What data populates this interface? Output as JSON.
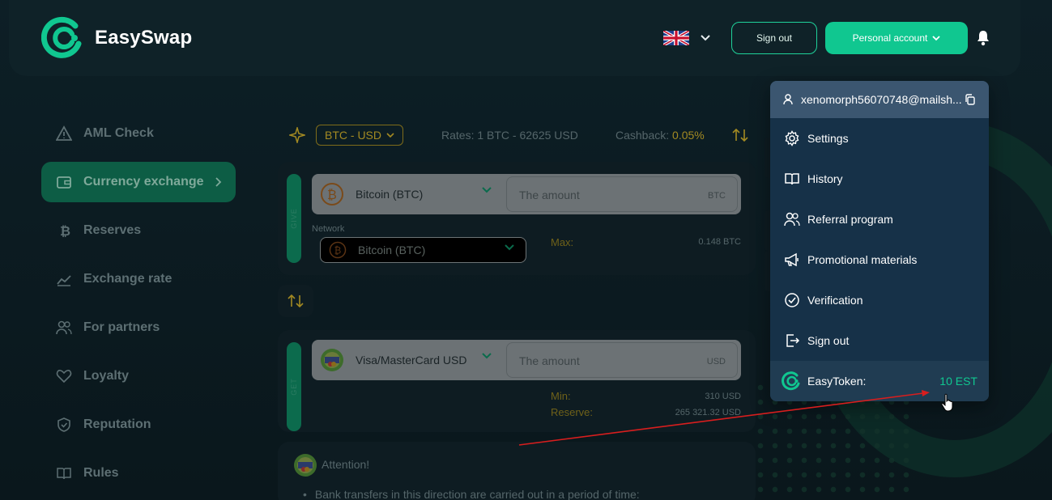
{
  "header": {
    "brand": "EasySwap",
    "sign_out_label": "Sign out",
    "account_label": "Personal account"
  },
  "sidebar": {
    "items": [
      {
        "label": "AML Check"
      },
      {
        "label": "Currency exchange"
      },
      {
        "label": "Reserves"
      },
      {
        "label": "Exchange rate"
      },
      {
        "label": "For partners"
      },
      {
        "label": "Loyalty"
      },
      {
        "label": "Reputation"
      },
      {
        "label": "Rules"
      }
    ]
  },
  "exchange": {
    "pair": "BTC - USD",
    "rates": "Rates: 1 BTC - 62625 USD",
    "cashback_label": "Cashback:",
    "cashback_value": "0.05%",
    "give": {
      "tag": "GIVE",
      "currency": "Bitcoin (BTC)",
      "amount_placeholder": "The amount",
      "amount_unit": "BTC",
      "network_label": "Network",
      "network_value": "Bitcoin (BTC)",
      "max_label": "Max:",
      "max_value": "0.148 BTC"
    },
    "get": {
      "tag": "GET",
      "currency": "Visa/MasterCard USD",
      "amount_placeholder": "The amount",
      "amount_unit": "USD",
      "min_label": "Min:",
      "min_value": "310 USD",
      "reserve_label": "Reserve:",
      "reserve_value": "265 321.32 USD"
    },
    "attention_title": "Attention!",
    "attention_text": "Bank transfers in this direction are carried out in a period of time:"
  },
  "account_menu": {
    "email": "xenomorph56070748@mailsh...",
    "items": [
      {
        "label": "Settings",
        "icon": "gear-icon"
      },
      {
        "label": "History",
        "icon": "book-icon"
      },
      {
        "label": "Referral program",
        "icon": "users-icon"
      },
      {
        "label": "Promotional materials",
        "icon": "megaphone-icon"
      },
      {
        "label": "Verification",
        "icon": "check-circle-icon"
      },
      {
        "label": "Sign out",
        "icon": "logout-icon"
      }
    ],
    "token_label": "EasyToken:",
    "token_value": "10 EST"
  },
  "colors": {
    "accent": "#10c790",
    "gold": "#a38a22",
    "menu_bg": "#163148"
  }
}
